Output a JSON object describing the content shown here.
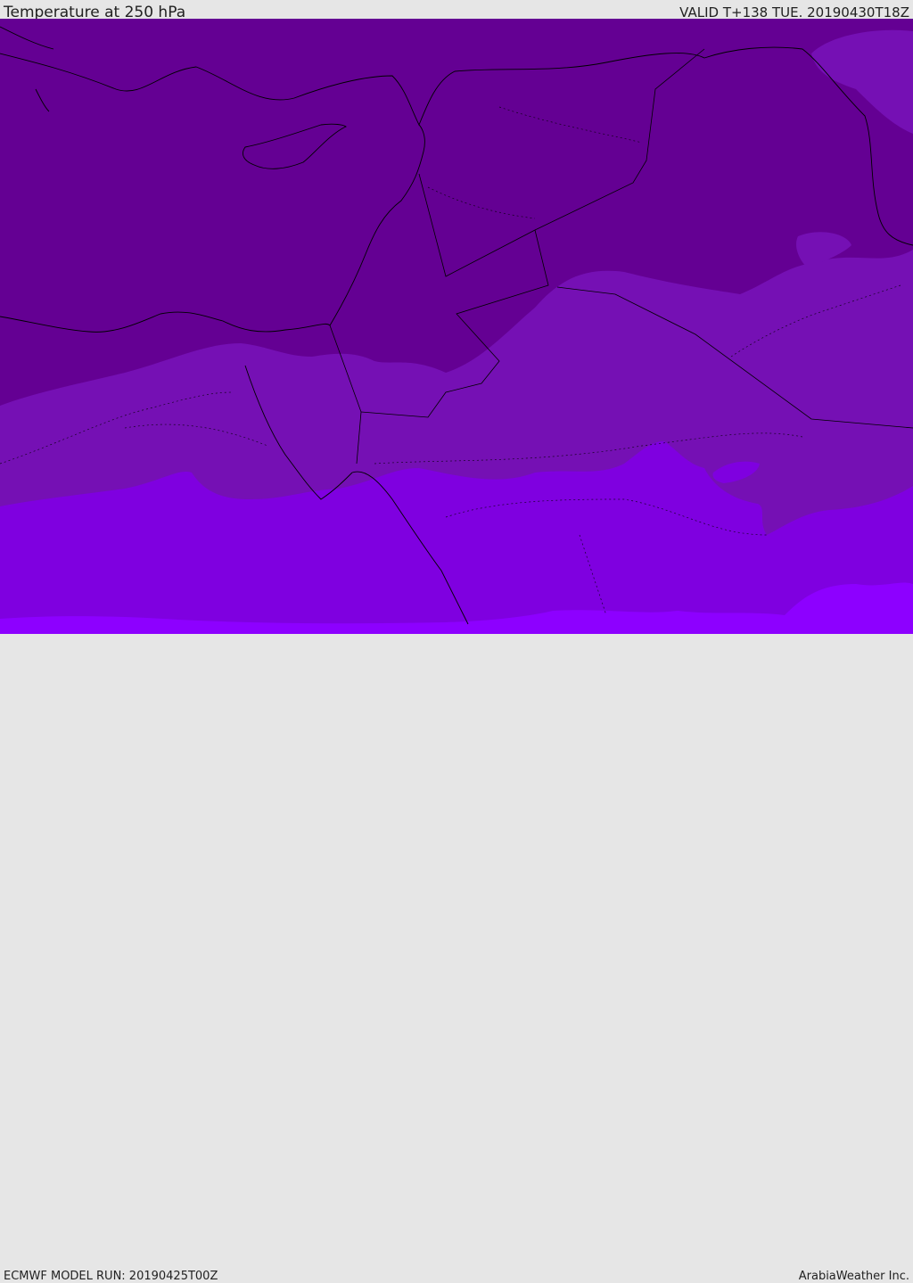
{
  "header": {
    "title": "Temperature at 250 hPa",
    "valid": "VALID T+138 TUE. 20190430T18Z"
  },
  "footer": {
    "model_run": "ECMWF MODEL RUN: 20190425T00Z",
    "brand": "ArabiaWeather Inc."
  },
  "map": {
    "fill_colors": [
      "#640093",
      "#7510b4",
      "#7f00e0",
      "#8d00ff"
    ],
    "coastline_color": "#000000",
    "border_color": "#000000"
  }
}
